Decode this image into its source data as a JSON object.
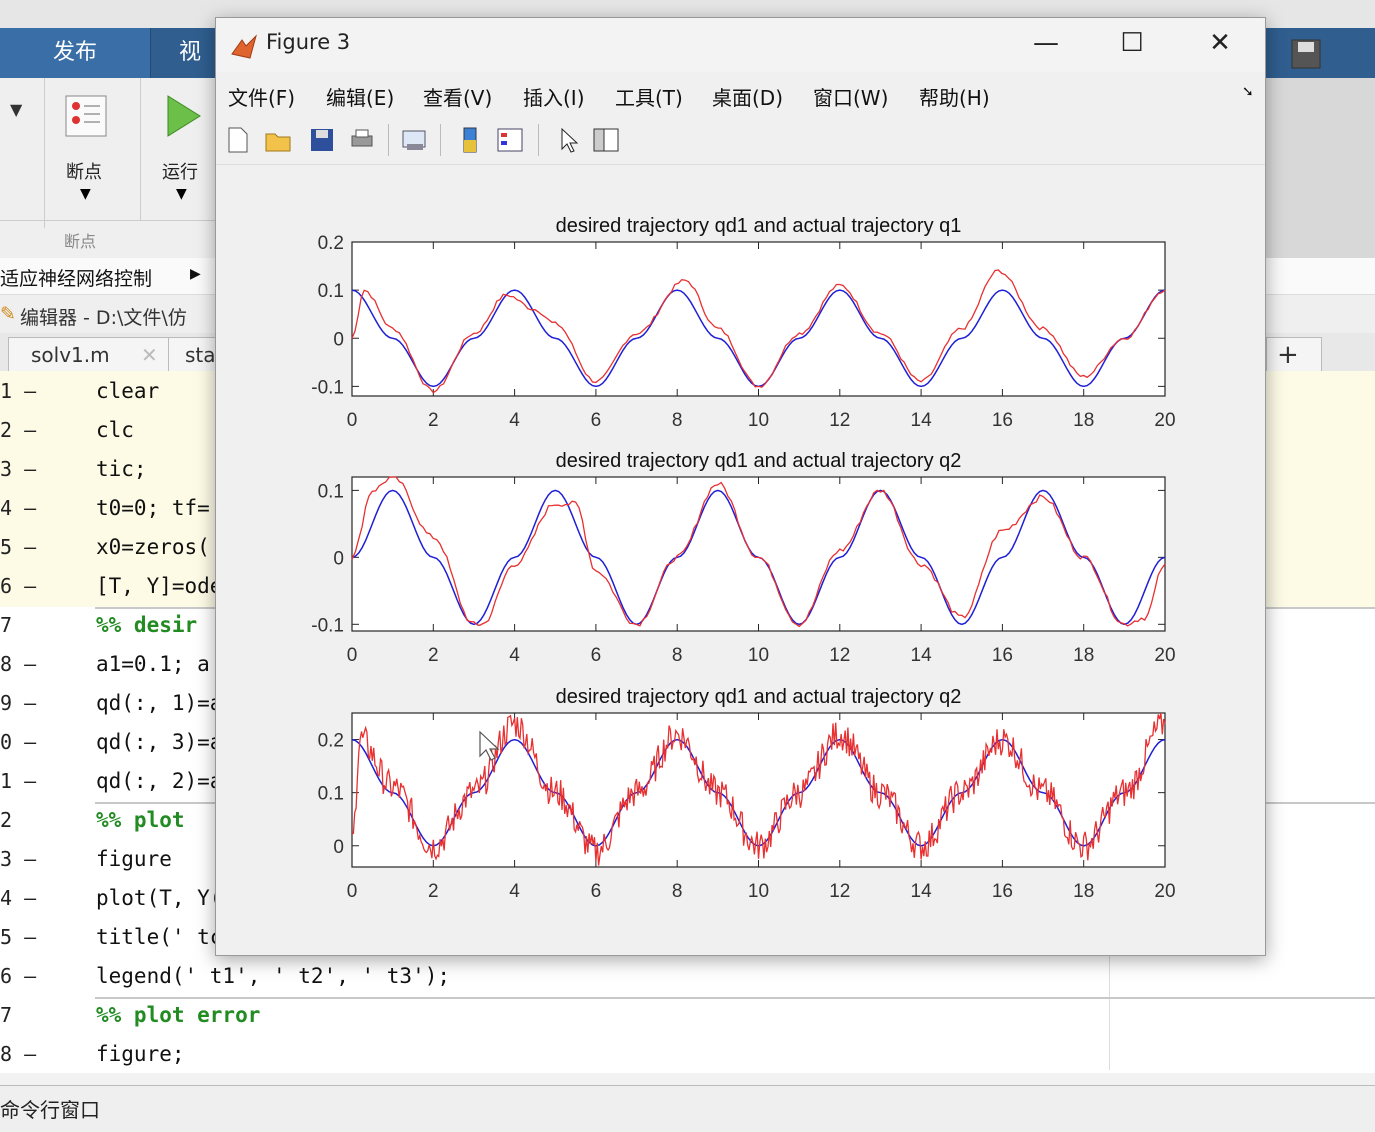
{
  "toolstrip": {
    "tabs": [
      "发布",
      "视"
    ],
    "breakpoints_label": "断点",
    "run_label": "运行",
    "group_label": "断点"
  },
  "editor": {
    "breadcrumb": "适应神经网络控制",
    "title": "编辑器 - D:\\文件\\仿",
    "tabs": [
      "solv1.m",
      "sta"
    ],
    "add_tab": "+",
    "line_numbers": [
      "1 —",
      "2 —",
      "3 —",
      "4 —",
      "5 —",
      "6 —",
      "7",
      "8 —",
      "9 —",
      "0 —",
      "1 —",
      "2",
      "3 —",
      "4 —",
      "5 —",
      "6 —",
      "7",
      "8 —"
    ],
    "lines": [
      {
        "t": "clear"
      },
      {
        "t": "clc"
      },
      {
        "t": "tic;"
      },
      {
        "t": "t0=0; tf="
      },
      {
        "t": "x0=zeros("
      },
      {
        "t": "[T, Y]=ode"
      },
      {
        "t": "%% desir"
      },
      {
        "t": "a1=0.1; a"
      },
      {
        "t": "qd(:, 1)=a"
      },
      {
        "t": "qd(:, 3)=a"
      },
      {
        "t": "qd(:, 2)=a"
      },
      {
        "t": "%% plot"
      },
      {
        "t": "figure"
      },
      {
        "t": "plot(T, Y("
      },
      {
        "t": "title(' tc"
      },
      {
        "t": "legend(' t1', ' t2', ' t3');"
      },
      {
        "t": "%% plot error"
      },
      {
        "t": "figure;"
      }
    ],
    "command_window": "命令行窗口"
  },
  "figure": {
    "title": "Figure 3",
    "controls": {
      "minimize": "—",
      "maximize": "☐",
      "close": "✕"
    },
    "menu": [
      "文件(F)",
      "编辑(E)",
      "查看(V)",
      "插入(I)",
      "工具(T)",
      "桌面(D)",
      "窗口(W)",
      "帮助(H)"
    ],
    "toolbar_icons": [
      "new-file-icon",
      "open-folder-icon",
      "save-icon",
      "print-icon",
      "link-plot-icon",
      "colorbar-icon",
      "legend-icon",
      "pointer-icon",
      "property-editor-icon"
    ]
  },
  "chart_data": [
    {
      "type": "line",
      "title": "desired trajectory qd1 and actual trajectory q1",
      "xlim": [
        0,
        20
      ],
      "ylim": [
        -0.12,
        0.2
      ],
      "xticks": [
        0,
        2,
        4,
        6,
        8,
        10,
        12,
        14,
        16,
        18,
        20
      ],
      "yticks": [
        -0.1,
        0,
        0.1,
        0.2
      ],
      "ytick_labels": [
        "-0.1",
        "0",
        "0.1",
        "0.2"
      ],
      "series": [
        {
          "color": "#1f1fd6",
          "x": [
            0,
            1,
            2,
            3,
            4,
            5,
            6,
            7,
            8,
            9,
            10,
            11,
            12,
            13,
            14,
            15,
            16,
            17,
            18,
            19,
            20
          ],
          "y": [
            0.1,
            0,
            -0.1,
            0,
            0.1,
            0,
            -0.1,
            0,
            0.1,
            0,
            -0.1,
            0,
            0.1,
            0,
            -0.1,
            0,
            0.1,
            0,
            -0.1,
            0,
            0.1
          ]
        },
        {
          "color": "#e83030",
          "x": [
            0,
            0.3,
            1,
            2,
            3,
            3.8,
            4.5,
            5,
            6,
            7,
            8.2,
            9,
            10,
            11,
            12,
            13,
            14,
            15,
            15.9,
            17,
            18,
            19,
            20
          ],
          "y": [
            0,
            0.1,
            0.02,
            -0.11,
            0.01,
            0.09,
            0.06,
            0.03,
            -0.09,
            0.01,
            0.12,
            0.02,
            -0.1,
            0.01,
            0.11,
            0.01,
            -0.09,
            0.02,
            0.14,
            0.02,
            -0.08,
            0.0,
            0.1
          ]
        }
      ]
    },
    {
      "type": "line",
      "title": "desired trajectory qd1 and actual trajectory q2",
      "xlim": [
        0,
        20
      ],
      "ylim": [
        -0.11,
        0.12
      ],
      "xticks": [
        0,
        2,
        4,
        6,
        8,
        10,
        12,
        14,
        16,
        18,
        20
      ],
      "yticks": [
        -0.1,
        0,
        0.1
      ],
      "ytick_labels": [
        "-0.1",
        "0",
        "0.1"
      ],
      "series": [
        {
          "color": "#1f1fd6",
          "x": [
            0,
            1,
            2,
            3,
            4,
            5,
            6,
            7,
            8,
            9,
            10,
            11,
            12,
            13,
            14,
            15,
            16,
            17,
            18,
            19,
            20
          ],
          "y": [
            0,
            0.1,
            0,
            -0.1,
            0,
            0.1,
            0,
            -0.1,
            0,
            0.1,
            0,
            -0.1,
            0,
            0.1,
            0,
            -0.1,
            0,
            0.1,
            0,
            -0.1,
            0
          ]
        },
        {
          "color": "#e83030",
          "x": [
            0,
            0.5,
            1,
            2,
            3,
            3.2,
            4,
            5,
            5.5,
            6,
            7,
            8,
            9,
            10,
            11,
            12,
            13,
            14,
            15,
            16,
            17,
            18,
            19,
            19.5,
            20
          ],
          "y": [
            0,
            0.1,
            0.12,
            0.03,
            -0.1,
            -0.1,
            -0.01,
            0.08,
            0.08,
            -0.02,
            -0.1,
            0.0,
            0.11,
            0.0,
            -0.1,
            0.01,
            0.1,
            -0.01,
            -0.09,
            0.04,
            0.09,
            0.0,
            -0.1,
            -0.09,
            -0.01
          ]
        }
      ]
    },
    {
      "type": "line",
      "title": "desired trajectory qd1 and actual trajectory q2",
      "xlim": [
        0,
        20
      ],
      "ylim": [
        -0.04,
        0.25
      ],
      "xticks": [
        0,
        2,
        4,
        6,
        8,
        10,
        12,
        14,
        16,
        18,
        20
      ],
      "yticks": [
        0,
        0.1,
        0.2
      ],
      "ytick_labels": [
        "0",
        "0.1",
        "0.2"
      ],
      "series": [
        {
          "color": "#1f1fd6",
          "x": [
            0,
            1,
            2,
            3,
            4,
            5,
            6,
            7,
            8,
            9,
            10,
            11,
            12,
            13,
            14,
            15,
            16,
            17,
            18,
            19,
            20
          ],
          "y": [
            0.2,
            0.1,
            0,
            0.1,
            0.2,
            0.1,
            0,
            0.1,
            0.2,
            0.1,
            0,
            0.1,
            0.2,
            0.1,
            0,
            0.1,
            0.2,
            0.1,
            0,
            0.1,
            0.2
          ]
        },
        {
          "color": "#e83030",
          "noise": 0.03,
          "x": [
            0,
            0.2,
            1,
            2,
            3,
            4,
            5,
            6,
            7,
            8,
            9,
            10,
            11,
            12,
            13,
            14,
            15,
            16,
            17,
            18,
            19,
            20
          ],
          "y": [
            0,
            0.2,
            0.11,
            0.0,
            0.1,
            0.23,
            0.1,
            -0.01,
            0.1,
            0.21,
            0.1,
            0.0,
            0.1,
            0.21,
            0.1,
            0.0,
            0.1,
            0.2,
            0.1,
            0.0,
            0.1,
            0.23
          ]
        }
      ]
    }
  ]
}
